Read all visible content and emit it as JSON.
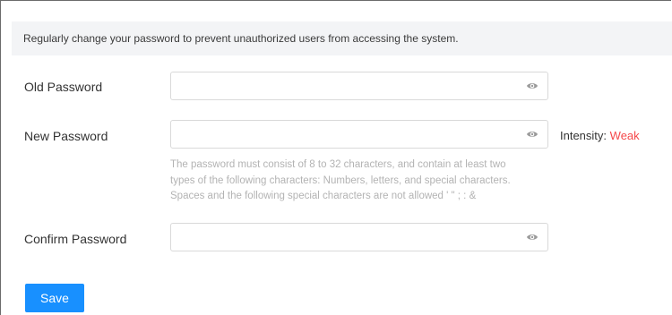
{
  "notice": "Regularly change your password to prevent unauthorized users from accessing the system.",
  "form": {
    "old_password": {
      "label": "Old Password",
      "value": "",
      "icon": "eye-icon"
    },
    "new_password": {
      "label": "New Password",
      "value": "",
      "icon": "eye-icon"
    },
    "confirm_password": {
      "label": "Confirm Password",
      "value": "",
      "icon": "eye-icon"
    }
  },
  "intensity": {
    "label": "Intensity:",
    "value": "Weak",
    "value_color": "#f5484a"
  },
  "hint": {
    "line1": "The password must consist of 8 to 32 characters, and contain at least two",
    "line2": "types of the following characters: Numbers, letters, and special characters.",
    "line3": "Spaces and the following special characters are not allowed ' \" ; : &"
  },
  "actions": {
    "save_label": "Save",
    "save_color": "#1890ff"
  }
}
